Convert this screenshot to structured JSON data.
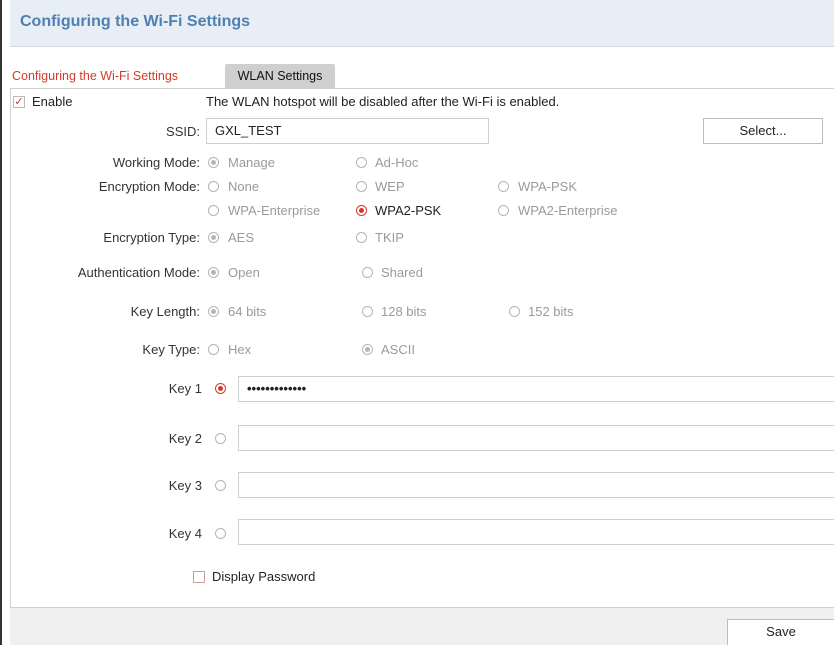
{
  "title": "Configuring the Wi-Fi Settings",
  "tabs": [
    {
      "label": "Configuring the Wi-Fi Settings",
      "active": true
    },
    {
      "label": "WLAN Settings",
      "active": false
    }
  ],
  "enable": {
    "label": "Enable",
    "checked": true
  },
  "notice": "The WLAN hotspot will be disabled after the Wi-Fi is enabled.",
  "ssid": {
    "label": "SSID:",
    "value": "GXL_TEST",
    "select_button": "Select..."
  },
  "working_mode": {
    "label": "Working Mode:",
    "options": [
      "Manage",
      "Ad-Hoc"
    ],
    "selected": "Manage"
  },
  "encryption_mode": {
    "label": "Encryption Mode:",
    "options": [
      "None",
      "WEP",
      "WPA-PSK",
      "WPA-Enterprise",
      "WPA2-PSK",
      "WPA2-Enterprise"
    ],
    "selected": "WPA2-PSK"
  },
  "encryption_type": {
    "label": "Encryption Type:",
    "options": [
      "AES",
      "TKIP"
    ],
    "selected": "AES"
  },
  "authentication_mode": {
    "label": "Authentication Mode:",
    "options": [
      "Open",
      "Shared"
    ],
    "selected": "Open"
  },
  "key_length": {
    "label": "Key Length:",
    "options": [
      "64 bits",
      "128 bits",
      "152 bits"
    ],
    "selected": "64 bits"
  },
  "key_type": {
    "label": "Key Type:",
    "options": [
      "Hex",
      "ASCII"
    ],
    "selected": "ASCII"
  },
  "keys": [
    {
      "label": "Key 1",
      "value": "•••••••••••••",
      "selected": true
    },
    {
      "label": "Key 2",
      "value": "",
      "selected": false
    },
    {
      "label": "Key 3",
      "value": "",
      "selected": false
    },
    {
      "label": "Key 4",
      "value": "",
      "selected": false
    }
  ],
  "display_password": {
    "label": "Display Password",
    "checked": false
  },
  "save_button": "Save",
  "colors": {
    "accent": "#d23b2b",
    "title": "#4f7fb3",
    "title_bar_bg": "#e8eef5"
  }
}
